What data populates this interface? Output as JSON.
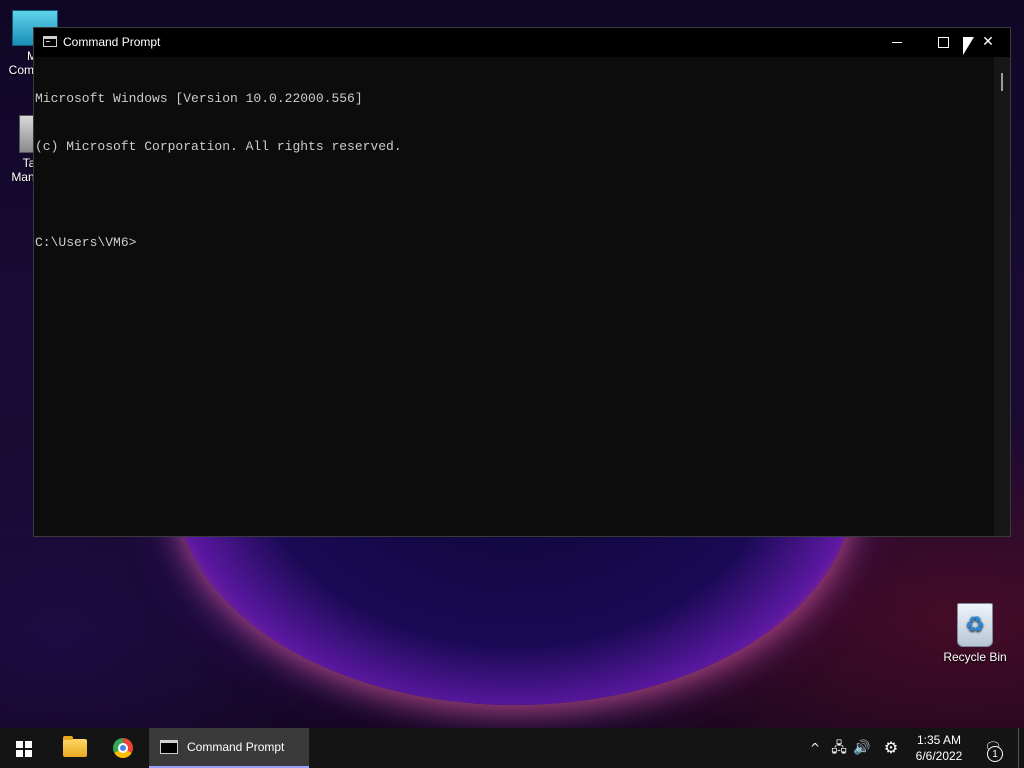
{
  "desktop": {
    "icons": [
      {
        "label": "My Computer",
        "icon": "monitor-icon"
      },
      {
        "label": "Task Manager",
        "icon": "task-manager-icon"
      },
      {
        "label": "Recycle Bin",
        "icon": "recycle-bin-icon"
      }
    ]
  },
  "window": {
    "title": "Command Prompt",
    "icon": "cmd-icon",
    "controls": {
      "minimize": "minimize-icon",
      "maximize": "maximize-icon",
      "close": "close-icon"
    },
    "console_lines": [
      "Microsoft Windows [Version 10.0.22000.556]",
      "(c) Microsoft Corporation. All rights reserved.",
      "",
      "C:\\Users\\VM6>"
    ],
    "background_color": "#0c0c0c",
    "text_color": "#cccccc"
  },
  "taskbar": {
    "start": "windows-logo-icon",
    "pinned": [
      {
        "name": "File Explorer",
        "icon": "folder-icon"
      },
      {
        "name": "Google Chrome",
        "icon": "chrome-icon"
      }
    ],
    "active_app": {
      "label": "Command Prompt",
      "icon": "cmd-icon"
    },
    "tray": {
      "chevron": "^",
      "network": "network-icon",
      "volume": "volume-icon",
      "settings": "gear-icon",
      "time": "1:35 AM",
      "date": "6/6/2022",
      "notification_count": "1"
    },
    "accent_color": "#9aa0ff"
  }
}
